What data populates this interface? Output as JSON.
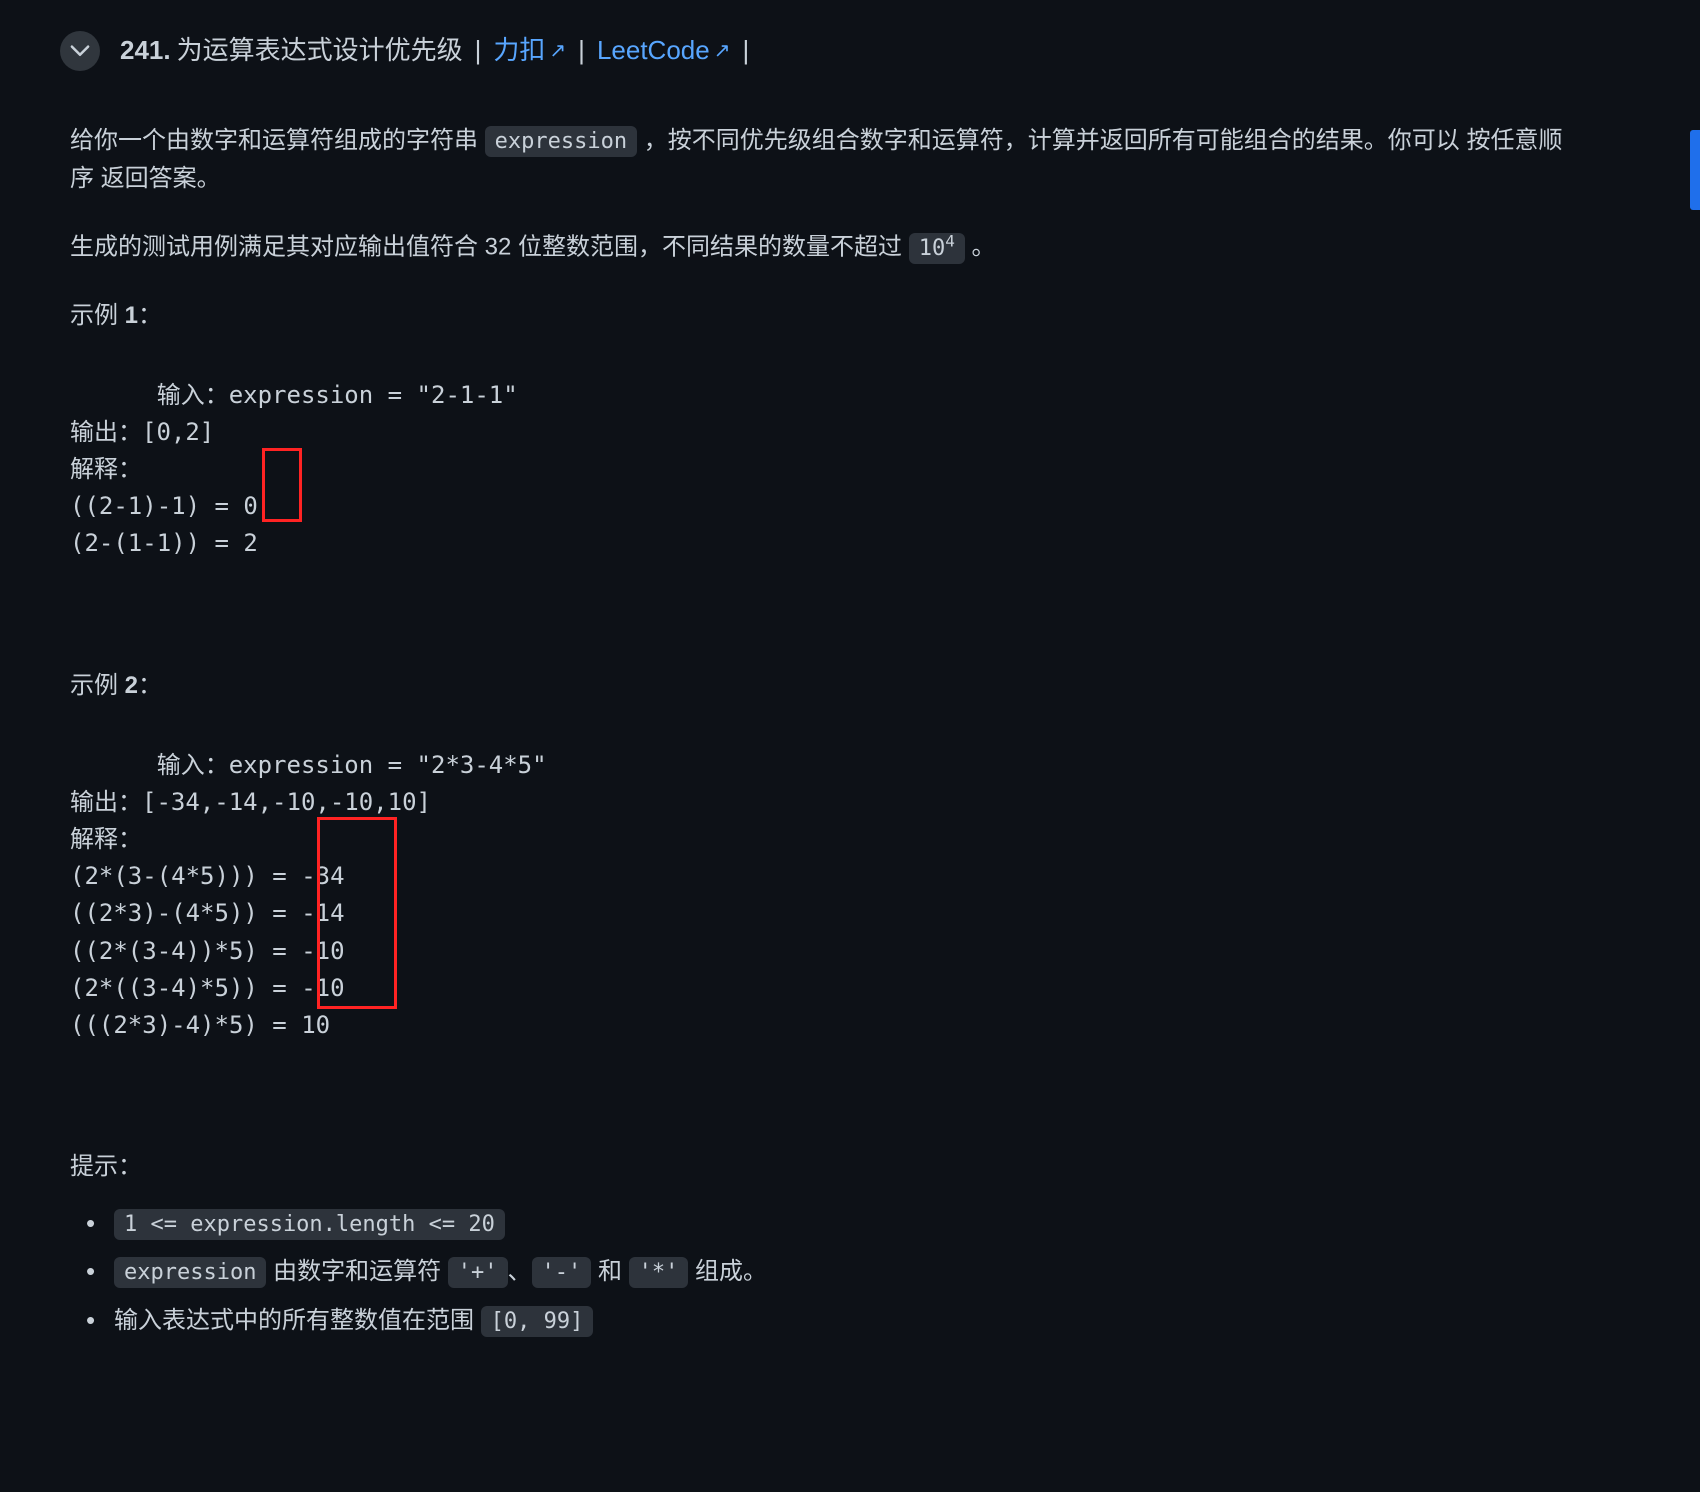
{
  "header": {
    "problem_number": "241.",
    "problem_title": "为运算表达式设计优先级",
    "link1_label": "力扣",
    "link2_label": "LeetCode"
  },
  "desc": {
    "p1_prefix": "给你一个由数字和运算符组成的字符串 ",
    "p1_code": "expression",
    "p1_suffix": " ，按不同优先级组合数字和运算符，计算并返回所有可能组合的结果。你可以 按任意顺序 返回答案。",
    "p2_prefix": "生成的测试用例满足其对应输出值符合 32 位整数范围，不同结果的数量不超过 ",
    "p2_code": "10",
    "p2_sup": "4",
    "p2_suffix": " 。"
  },
  "ex1": {
    "label_prefix": "示例 ",
    "label_num": "1",
    "label_suffix": "：",
    "block": "输入：expression = \"2-1-1\"\n输出：[0,2]\n解释：\n((2-1)-1) = 0\n(2-(1-1)) = 2"
  },
  "ex2": {
    "label_prefix": "示例 ",
    "label_num": "2",
    "label_suffix": "：",
    "block": "输入：expression = \"2*3-4*5\"\n输出：[-34,-14,-10,-10,10]\n解释：\n(2*(3-(4*5))) = -34\n((2*3)-(4*5)) = -14\n((2*(3-4))*5) = -10\n(2*((3-4)*5)) = -10\n(((2*3)-4)*5) = 10"
  },
  "hints": {
    "label": "提示：",
    "item1": "1 <= expression.length <= 20",
    "item2_code1": "expression",
    "item2_mid1": " 由数字和运算符 ",
    "item2_code2": "'+'",
    "item2_sep1": "、",
    "item2_code3": "'-'",
    "item2_mid2": " 和 ",
    "item2_code4": "'*'",
    "item2_suffix": " 组成。",
    "item3_prefix": "输入表达式中的所有整数值在范围 ",
    "item3_code": "[0, 99]"
  }
}
